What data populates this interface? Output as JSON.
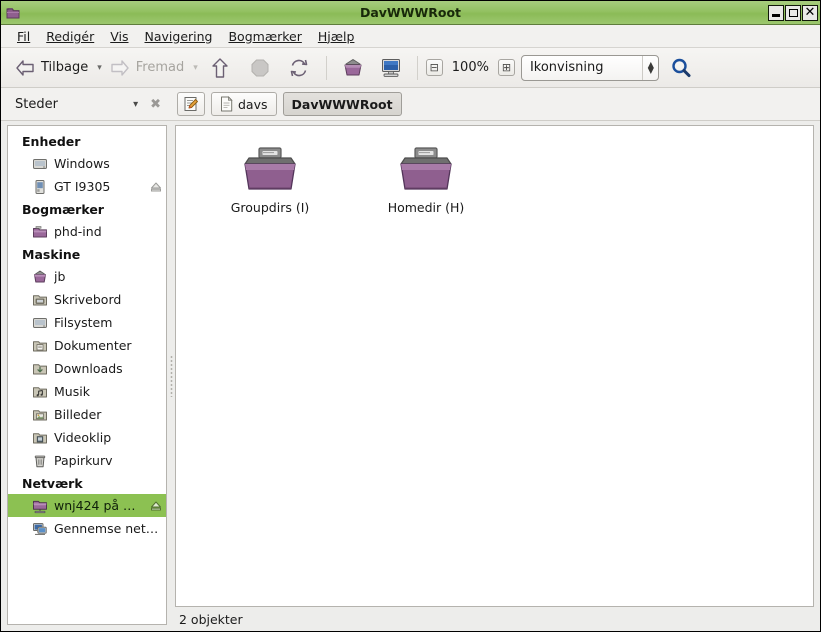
{
  "window": {
    "title": "DavWWWRoot",
    "icon": "folder-icon",
    "controls": {
      "minimize": "minimize-button",
      "maximize": "maximize-button",
      "close": "close-button",
      "close_glyph": "✕"
    }
  },
  "menubar": {
    "items": [
      {
        "label": "Fil",
        "accel": "F"
      },
      {
        "label": "Redigér",
        "accel": "R"
      },
      {
        "label": "Vis",
        "accel": "V"
      },
      {
        "label": "Navigering",
        "accel": "N"
      },
      {
        "label": "Bogmærker",
        "accel": "B"
      },
      {
        "label": "Hjælp",
        "accel": "H"
      }
    ]
  },
  "toolbar": {
    "back_label": "Tilbage",
    "forward_label": "Fremad",
    "up_icon": "arrow-up-icon",
    "stop_icon": "stop-icon",
    "reload_icon": "reload-icon",
    "home_icon": "home-folder-icon",
    "computer_icon": "computer-icon",
    "zoom_out_glyph": "⊟",
    "zoom_level": "100%",
    "zoom_in_glyph": "⊞",
    "view_mode": "Ikonvisning",
    "search_icon": "search-icon",
    "chevron_glyph": "▾"
  },
  "places_panel": {
    "title": "Steder",
    "chevron_glyph": "▾",
    "close_glyph": "✖"
  },
  "breadcrumb": {
    "edit_button": "edit-location-button",
    "items": [
      {
        "label": "davs",
        "icon": "document-icon",
        "active": false
      },
      {
        "label": "DavWWWRoot",
        "icon": "none",
        "active": true
      }
    ]
  },
  "sidebar": {
    "groups": [
      {
        "title": "Enheder",
        "items": [
          {
            "label": "Windows",
            "icon": "drive-harddisk-icon",
            "eject": false,
            "selected": false
          },
          {
            "label": "GT I9305",
            "icon": "phone-icon",
            "eject": true,
            "selected": false
          }
        ]
      },
      {
        "title": "Bogmærker",
        "items": [
          {
            "label": "phd-ind",
            "icon": "folder-icon",
            "eject": false,
            "selected": false
          }
        ]
      },
      {
        "title": "Maskine",
        "items": [
          {
            "label": "jb",
            "icon": "home-folder-icon",
            "eject": false,
            "selected": false
          },
          {
            "label": "Skrivebord",
            "icon": "desktop-folder-icon",
            "eject": false,
            "selected": false
          },
          {
            "label": "Filsystem",
            "icon": "drive-harddisk-icon",
            "eject": false,
            "selected": false
          },
          {
            "label": "Dokumenter",
            "icon": "documents-folder-icon",
            "eject": false,
            "selected": false
          },
          {
            "label": "Downloads",
            "icon": "downloads-folder-icon",
            "eject": false,
            "selected": false
          },
          {
            "label": "Musik",
            "icon": "music-folder-icon",
            "eject": false,
            "selected": false
          },
          {
            "label": "Billeder",
            "icon": "pictures-folder-icon",
            "eject": false,
            "selected": false
          },
          {
            "label": "Videoklip",
            "icon": "videos-folder-icon",
            "eject": false,
            "selected": false
          },
          {
            "label": "Papirkurv",
            "icon": "trash-icon",
            "eject": false,
            "selected": false
          }
        ]
      },
      {
        "title": "Netværk",
        "items": [
          {
            "label": "wnj424 på …",
            "icon": "network-folder-icon",
            "eject": true,
            "selected": true
          },
          {
            "label": "Gennemse net…",
            "icon": "network-browse-icon",
            "eject": false,
            "selected": false
          }
        ]
      }
    ]
  },
  "files": {
    "items": [
      {
        "label": "Groupdirs (I)",
        "icon": "remote-folder-icon"
      },
      {
        "label": "Homedir (H)",
        "icon": "remote-folder-icon"
      }
    ]
  },
  "statusbar": {
    "text": "2 objekter"
  },
  "colors": {
    "titlebar_green": "#93c162",
    "selection_green": "#8cc152",
    "folder_purple": "#8f5f8f",
    "window_bg": "#ededeb",
    "panel_bg": "#ffffff"
  }
}
